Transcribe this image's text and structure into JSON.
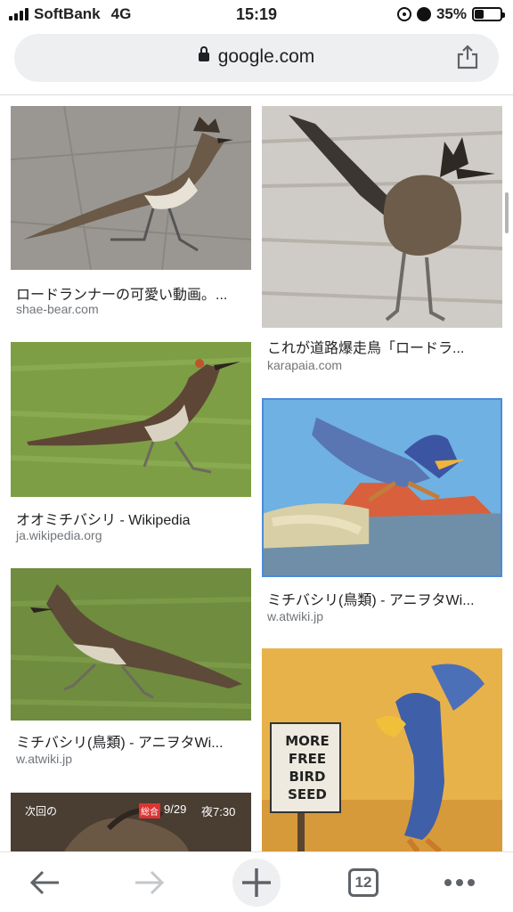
{
  "status_bar": {
    "carrier": "SoftBank",
    "network": "4G",
    "time": "15:19",
    "battery": "35%",
    "battery_level": 0.35
  },
  "url_bar": {
    "domain": "google.com",
    "lock_icon": "lock-icon",
    "share_icon": "share-icon"
  },
  "results": [
    {
      "title": "ロードランナーの可愛い動画。...",
      "source": "shae-bear.com"
    },
    {
      "title": "これが道路爆走鳥「ロードラ...",
      "source": "karapaia.com"
    },
    {
      "title": "オオミチバシリ - Wikipedia",
      "source": "ja.wikipedia.org"
    },
    {
      "title": "ミチバシリ(鳥類) - アニヲタWi...",
      "source": "w.atwiki.jp"
    },
    {
      "title": "ミチバシリ(鳥類) - アニヲタWi...",
      "source": "w.atwiki.jp"
    },
    {
      "title": "",
      "source": ""
    }
  ],
  "image_texts": {
    "sign_line1": "MORE",
    "sign_line2": "FREE",
    "sign_line3": "BIRD",
    "sign_line4": "SEED",
    "tv_caption_left": "次回の",
    "tv_caption_date": "9/29",
    "tv_caption_time": "夜7:30",
    "tv_badge": "総合"
  },
  "toolbar": {
    "back_icon": "back-arrow-icon",
    "forward_icon": "forward-arrow-icon",
    "new_tab_icon": "plus-icon",
    "tab_count": "12",
    "menu_icon": "more-dots-icon"
  },
  "colors": {
    "accent_link": "#202124",
    "source_gray": "#70757a",
    "url_bg": "#eeeff1"
  }
}
